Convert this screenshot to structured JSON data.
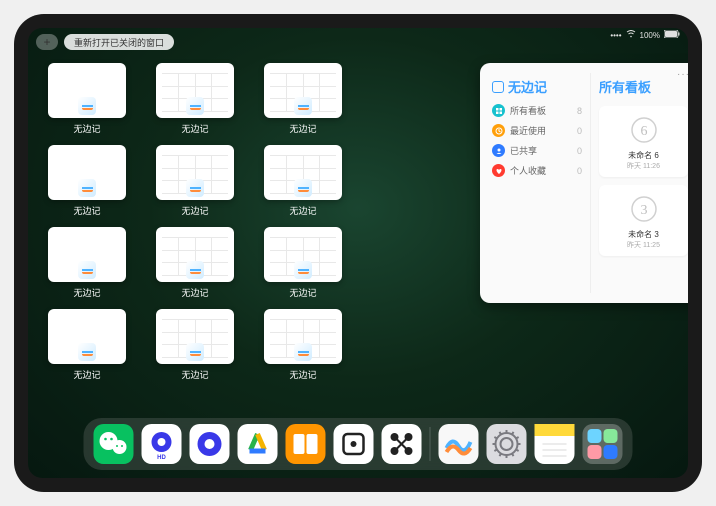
{
  "status": {
    "signal": "••••",
    "wifi": "wifi",
    "battery": "100%"
  },
  "topbar": {
    "plus_label": "+",
    "reopen_label": "重新打开已关闭的窗口"
  },
  "app_name": "无边记",
  "thumbnails": [
    {
      "label": "无边记",
      "blank": true
    },
    {
      "label": "无边记",
      "blank": false
    },
    {
      "label": "无边记",
      "blank": false
    },
    null,
    {
      "label": "无边记",
      "blank": true
    },
    {
      "label": "无边记",
      "blank": false
    },
    {
      "label": "无边记",
      "blank": false
    },
    null,
    {
      "label": "无边记",
      "blank": true
    },
    {
      "label": "无边记",
      "blank": false
    },
    {
      "label": "无边记",
      "blank": false
    },
    null,
    {
      "label": "无边记",
      "blank": true
    },
    {
      "label": "无边记",
      "blank": false
    },
    {
      "label": "无边记",
      "blank": false
    }
  ],
  "panel": {
    "more": "···",
    "title": "无边记",
    "nav": [
      {
        "icon": "grid",
        "color": "#17c1ce",
        "label": "所有看板",
        "count": "8"
      },
      {
        "icon": "clock",
        "color": "#ff9f0a",
        "label": "最近使用",
        "count": "0"
      },
      {
        "icon": "person",
        "color": "#2f7bff",
        "label": "已共享",
        "count": "0"
      },
      {
        "icon": "heart",
        "color": "#ff3b30",
        "label": "个人收藏",
        "count": "0"
      }
    ],
    "right_title": "所有看板",
    "boards": [
      {
        "scribble": "6",
        "name": "未命名 6",
        "date": "昨天 11:26"
      },
      {
        "scribble": "3",
        "name": "未命名 3",
        "date": "昨天 11:25"
      }
    ]
  },
  "dock": [
    {
      "name": "wechat"
    },
    {
      "name": "quark-hd"
    },
    {
      "name": "quark"
    },
    {
      "name": "aliyun"
    },
    {
      "name": "books"
    },
    {
      "name": "dice"
    },
    {
      "name": "nodes"
    },
    {
      "name": "freeform"
    },
    {
      "name": "settings"
    },
    {
      "name": "notes"
    },
    {
      "name": "widgets"
    }
  ]
}
